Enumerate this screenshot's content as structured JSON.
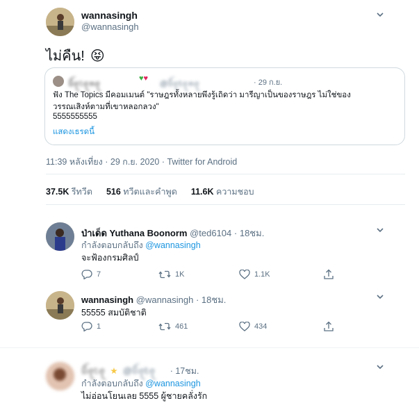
{
  "tweet": {
    "display_name": "wannasingh",
    "handle": "@wannasingh",
    "text": "ไม่คืน!",
    "emoji": "😝",
    "quoted": {
      "display_name": "ꪶᥣꪖ𝕥ꪖꪀꪖ",
      "handle": "@ꪶᥣꪖ𝕥ꪖꪀꪖ",
      "time": "· 29 ก.ย.",
      "line1": "ฟัง The Topics มีคอมเมนต์ \"ราษฎรทั้งหลายพึงรู้เถิดว่า มารีญาเป็นของราษฎร ไม่ใช่ของ",
      "line2": "วรรณเสิงห์ตามที่เขาหลอกลวง\"",
      "line3": "5555555555",
      "show_thread": "แสดงเธรดนี้"
    },
    "meta": "11:39 หลังเที่ยง · 29 ก.ย. 2020 · Twitter for Android",
    "stats": {
      "retweets_count": "37.5K",
      "retweets_label": "รีทวีต",
      "quotes_count": "516",
      "quotes_label": "ทวีตและคำพูด",
      "likes_count": "11.6K",
      "likes_label": "ความชอบ"
    }
  },
  "replies": [
    {
      "display_name": "ป่าเด็ด Yuthana Boonorm",
      "handle": "@ted6104",
      "time": "· 18ชม.",
      "replying_label": "กำลังตอบกลับถึง",
      "replying_to": "@wannasingh",
      "text": "จะฟ้องกรมศิลป์",
      "reply_count": "7",
      "retweet_count": "1K",
      "like_count": "1.1K"
    },
    {
      "display_name": "wannasingh",
      "handle": "@wannasingh",
      "time": "· 18ชม.",
      "text": "55555 สมบัติชาติ",
      "reply_count": "1",
      "retweet_count": "461",
      "like_count": "434"
    },
    {
      "display_name": "ꪶᥣꪖ𝕥ꪖ",
      "handle": "@ꪶᥣꪖ𝕥ꪖ",
      "time": "· 17ชม.",
      "replying_label": "กำลังตอบกลับถึง",
      "replying_to": "@wannasingh",
      "text": "ไม่อ่อนโยนเลย 5555 ผู้ชายคลั่งรัก"
    }
  ],
  "colors": {
    "link": "#1b95e0",
    "muted": "#5b7083",
    "border": "#cfd9de",
    "like": "#e0245e"
  }
}
